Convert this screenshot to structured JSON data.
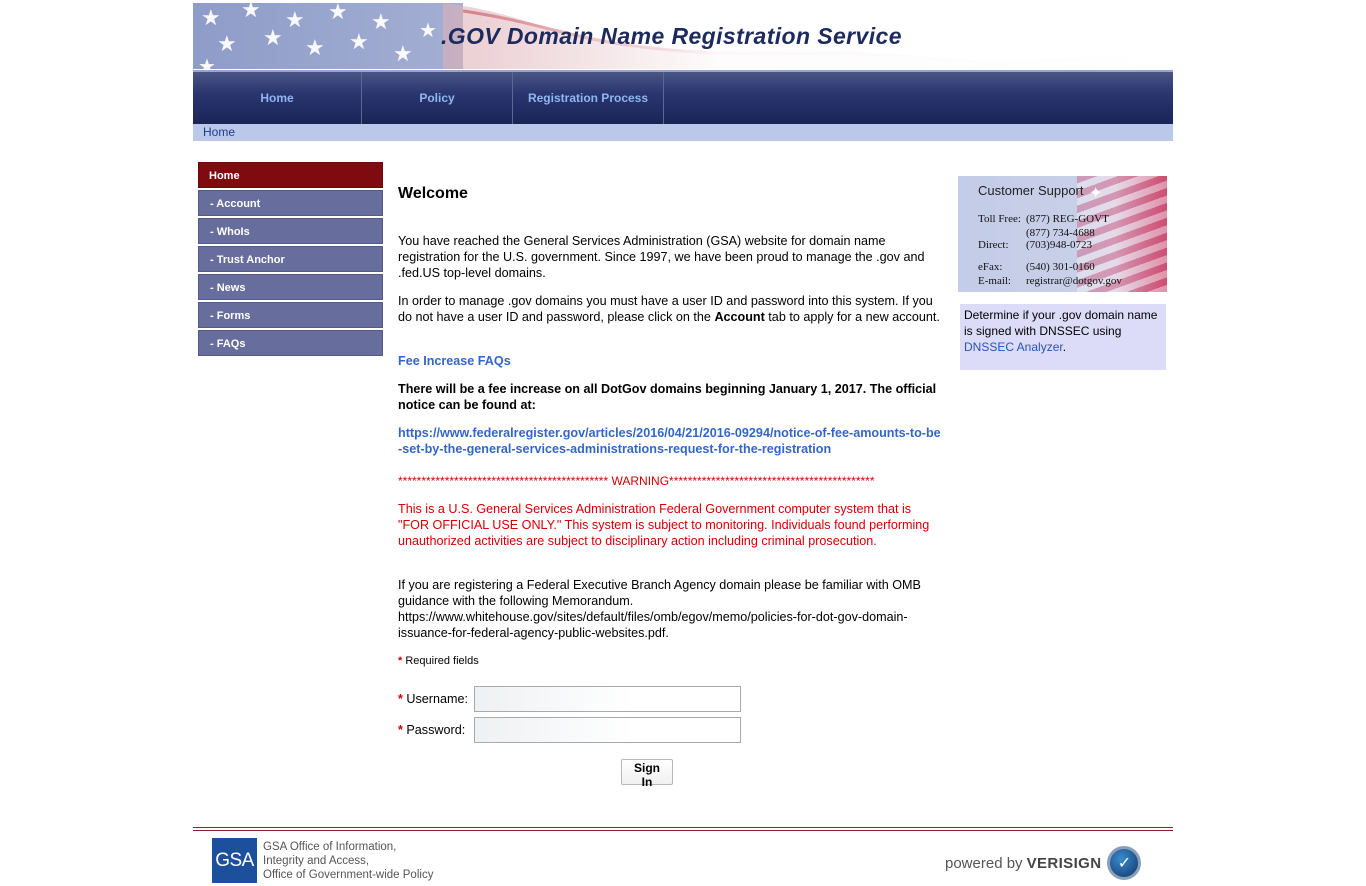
{
  "banner": {
    "title": ".GOV Domain Name Registration Service"
  },
  "nav": {
    "tabs": [
      "Home",
      "Policy",
      "Registration Process"
    ]
  },
  "breadcrumb": {
    "current": "Home"
  },
  "sidebar": {
    "items": [
      "Home",
      "- Account",
      "- WhoIs",
      "- Trust Anchor",
      "- News",
      "- Forms",
      "- FAQs"
    ]
  },
  "main": {
    "heading": "Welcome",
    "intro": "You have reached the General Services Administration (GSA) website for domain name registration for the U.S. government. Since 1997, we have been proud to manage the .gov and .fed.US top-level domains.",
    "manage_pre": "In order to manage .gov domains you must have a user ID and password into this system. If you do not have a user ID and password, please click on the ",
    "manage_bold": "Account",
    "manage_post": " tab to apply for a new account.",
    "fee_link": "Fee Increase FAQs",
    "fee_notice": "There will be a fee increase on all DotGov domains beginning January 1, 2017.  The official notice can be found at:",
    "federal_register_link": "https://www.federalregister.gov/articles/2016/04/21/2016-09294/notice-of-fee-amounts-to-be-set-by-the-general-services-administrations-request-for-the-registration",
    "warning_header": "********************************************* WARNING********************************************",
    "warning_body": "This is a U.S. General Services Administration Federal Government computer system that is \"FOR OFFICIAL USE ONLY.\" This system is subject to monitoring.  Individuals found performing unauthorized activities are subject to disciplinary action including criminal prosecution.",
    "omb_text": "If you are registering a Federal Executive Branch Agency domain please be familiar with OMB guidance with the following Memorandum. https://www.whitehouse.gov/sites/default/files/omb/egov/memo/policies-for-dot-gov-domain-issuance-for-federal-agency-public-websites.pdf.",
    "required_note": "Required fields",
    "required_marker": "*"
  },
  "login": {
    "username_label": "Username:",
    "username_value": "",
    "password_label": "Password:",
    "password_value": "",
    "signin_label": "Sign In"
  },
  "support": {
    "title": "Customer Support",
    "toll_free_label": "Toll Free:",
    "toll_free_1": "(877) REG-GOVT",
    "toll_free_2": "(877) 734-4688",
    "direct_label": "Direct:",
    "direct": "(703)948-0723",
    "efax_label": "eFax:",
    "efax": "(540) 301-0160",
    "email_label": "E-mail:",
    "email": "registrar@dotgov.gov"
  },
  "dnssec": {
    "text": "Determine if your .gov domain name is signed with DNSSEC using",
    "link": "DNSSEC Analyzer",
    "suffix": "."
  },
  "footer": {
    "gsa_logo": "GSA",
    "gsa_line1": "GSA Office of Information,",
    "gsa_line2": "Integrity and Access,",
    "gsa_line3": "Office of Government-wide Policy",
    "powered_by": "powered by",
    "verisign": "VERISIGN"
  },
  "colors": {
    "nav_dark": "#1a2458",
    "nav_text": "#8fb6f2",
    "sidebar": "#676d9c",
    "sidebar_active": "#7f0a10",
    "link": "#3366cc",
    "warning": "#d40000"
  }
}
